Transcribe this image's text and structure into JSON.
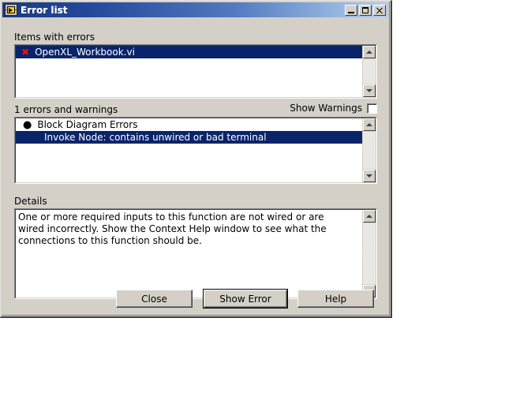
{
  "window": {
    "title": "Error list",
    "icon": "labview-vi-icon",
    "controls": {
      "minimize": "minimize-button",
      "maximize": "maximize-button",
      "close": "close-button"
    }
  },
  "items_with_errors": {
    "label": "Items with errors",
    "rows": [
      {
        "icon": "red-x-icon",
        "text": "OpenXL_Workbook.vi",
        "selected": true
      }
    ]
  },
  "errors_and_warnings": {
    "label": "1 errors and warnings",
    "show_warnings_label": "Show Warnings",
    "show_warnings_checked": false,
    "rows": [
      {
        "icon": "bullet-icon",
        "text": "Block Diagram Errors",
        "selected": false,
        "indent": false
      },
      {
        "icon": "",
        "text": "Invoke Node: contains unwired or bad terminal",
        "selected": true,
        "indent": true
      }
    ]
  },
  "details": {
    "label": "Details",
    "text": "One or more required inputs to this function are not wired or are wired incorrectly. Show the Context Help window to see what the connections to this function should be."
  },
  "buttons": {
    "close": "Close",
    "show_error": "Show Error",
    "help": "Help"
  },
  "colors": {
    "title_bar_start": "#1b3a80",
    "title_bar_end": "#b4cdee",
    "selection": "#0a246a",
    "face": "#d4d0c8",
    "error_x": "#d00000"
  }
}
